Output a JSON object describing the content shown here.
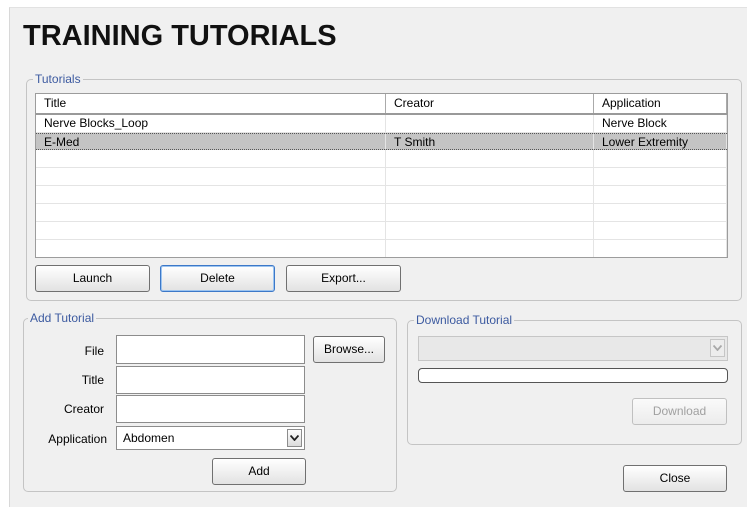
{
  "title": "TRAINING TUTORIALS",
  "tutorials": {
    "legend": "Tutorials",
    "columns": [
      "Title",
      "Creator",
      "Application"
    ],
    "rows": [
      {
        "title": "Nerve Blocks_Loop",
        "creator": "",
        "application": "Nerve Block",
        "selected": false
      },
      {
        "title": "E-Med",
        "creator": "T Smith",
        "application": "Lower Extremity",
        "selected": true
      }
    ],
    "buttons": {
      "launch": "Launch",
      "delete": "Delete",
      "export": "Export..."
    }
  },
  "add_tutorial": {
    "legend": "Add Tutorial",
    "file_label": "File",
    "file_value": "",
    "browse_label": "Browse...",
    "title_label": "Title",
    "title_value": "",
    "creator_label": "Creator",
    "creator_value": "",
    "application_label": "Application",
    "application_value": "Abdomen",
    "add_label": "Add"
  },
  "download_tutorial": {
    "legend": "Download Tutorial",
    "selected_value": "",
    "progress": 0,
    "download_label": "Download"
  },
  "close_label": "Close",
  "colors": {
    "legend": "#3c5aa0",
    "selected_row": "#c4c4c4",
    "panel": "#f0f0f0"
  }
}
